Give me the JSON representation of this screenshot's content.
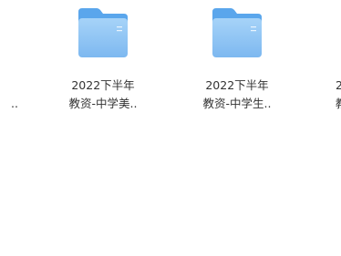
{
  "files": [
    {
      "id": "left-partial",
      "line1": "",
      "line2": "..",
      "visible": true
    },
    {
      "id": "1",
      "line1": "2022下半年",
      "line2": "教资-中学美..",
      "visible": true
    },
    {
      "id": "2",
      "line1": "2022下半年",
      "line2": "教资-中学生..",
      "visible": true
    },
    {
      "id": "right-partial",
      "line1": "2",
      "line2": "教",
      "visible": true
    }
  ],
  "folder_colors": {
    "back": "#5aa6ec",
    "front_top": "#9ccdf7",
    "front_bottom": "#7ab7f1",
    "lines": "#e9f4fe"
  }
}
